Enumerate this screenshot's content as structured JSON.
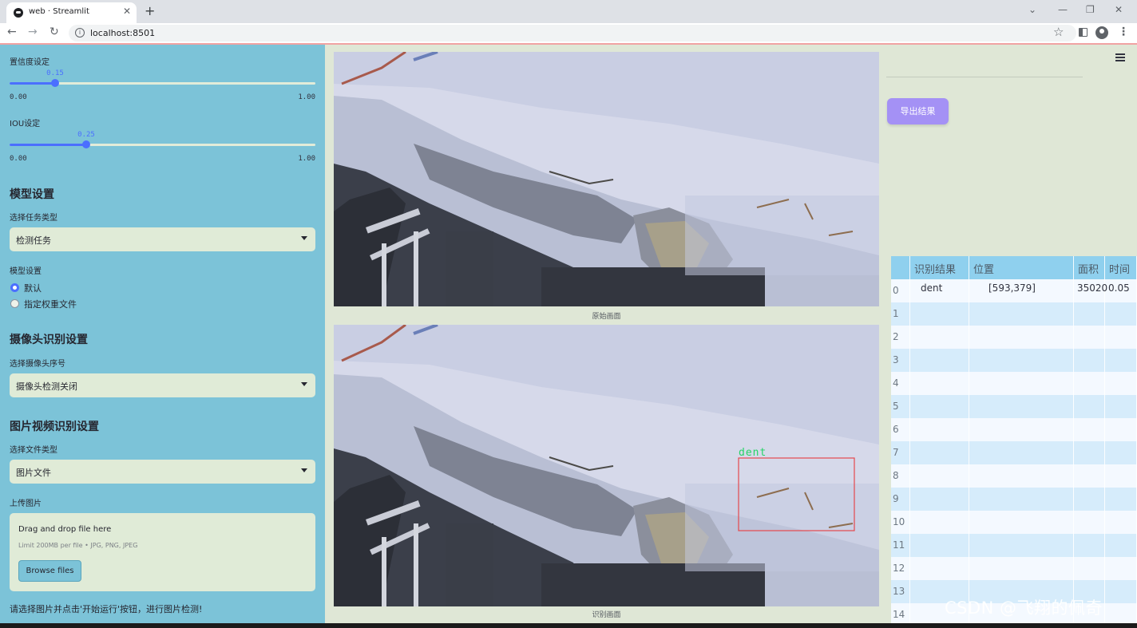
{
  "browser": {
    "tab_title": "web · Streamlit",
    "url": "localhost:8501"
  },
  "sidebar": {
    "confidence": {
      "label": "置信度设定",
      "value": "0.15",
      "min": "0.00",
      "max": "1.00",
      "fraction": 0.15
    },
    "iou": {
      "label": "IOU设定",
      "value": "0.25",
      "min": "0.00",
      "max": "1.00",
      "fraction": 0.25
    },
    "model_header": "模型设置",
    "task_label": "选择任务类型",
    "task_value": "检测任务",
    "model_label": "模型设置",
    "model_options": [
      {
        "label": "默认",
        "selected": true
      },
      {
        "label": "指定权重文件",
        "selected": false
      }
    ],
    "camera_header": "摄像头识别设置",
    "camera_label": "选择摄像头序号",
    "camera_value": "摄像头检测关闭",
    "media_header": "图片视频识别设置",
    "filetype_label": "选择文件类型",
    "filetype_value": "图片文件",
    "upload_label": "上传图片",
    "dropzone_title": "Drag and drop file here",
    "dropzone_limit": "Limit 200MB per file • JPG, PNG, JPEG",
    "browse_label": "Browse files",
    "hint": "请选择图片并点击'开始运行'按钮，进行图片检测!"
  },
  "main": {
    "original_caption": "原始画面",
    "result_caption": "识别画面",
    "detection_label": "dent",
    "export_label": "导出结果"
  },
  "table": {
    "columns": [
      "识别结果",
      "位置",
      "面积",
      "时间"
    ],
    "rows": [
      {
        "index": "0",
        "result": "dent",
        "position": "[593,379]",
        "area": "35020",
        "time": "0.05"
      },
      {
        "index": "1"
      },
      {
        "index": "2"
      },
      {
        "index": "3"
      },
      {
        "index": "4"
      },
      {
        "index": "5"
      },
      {
        "index": "6"
      },
      {
        "index": "7"
      },
      {
        "index": "8"
      },
      {
        "index": "9"
      },
      {
        "index": "10"
      },
      {
        "index": "11"
      },
      {
        "index": "12"
      },
      {
        "index": "13"
      },
      {
        "index": "14"
      }
    ]
  },
  "watermark": "CSDN @飞翔的佩奇",
  "colors": {
    "sidebar": "#7cc3d8",
    "accent": "#4b6fff",
    "export_button": "#a491f5",
    "bbox": "#e5484d",
    "label_text": "#25d366"
  }
}
